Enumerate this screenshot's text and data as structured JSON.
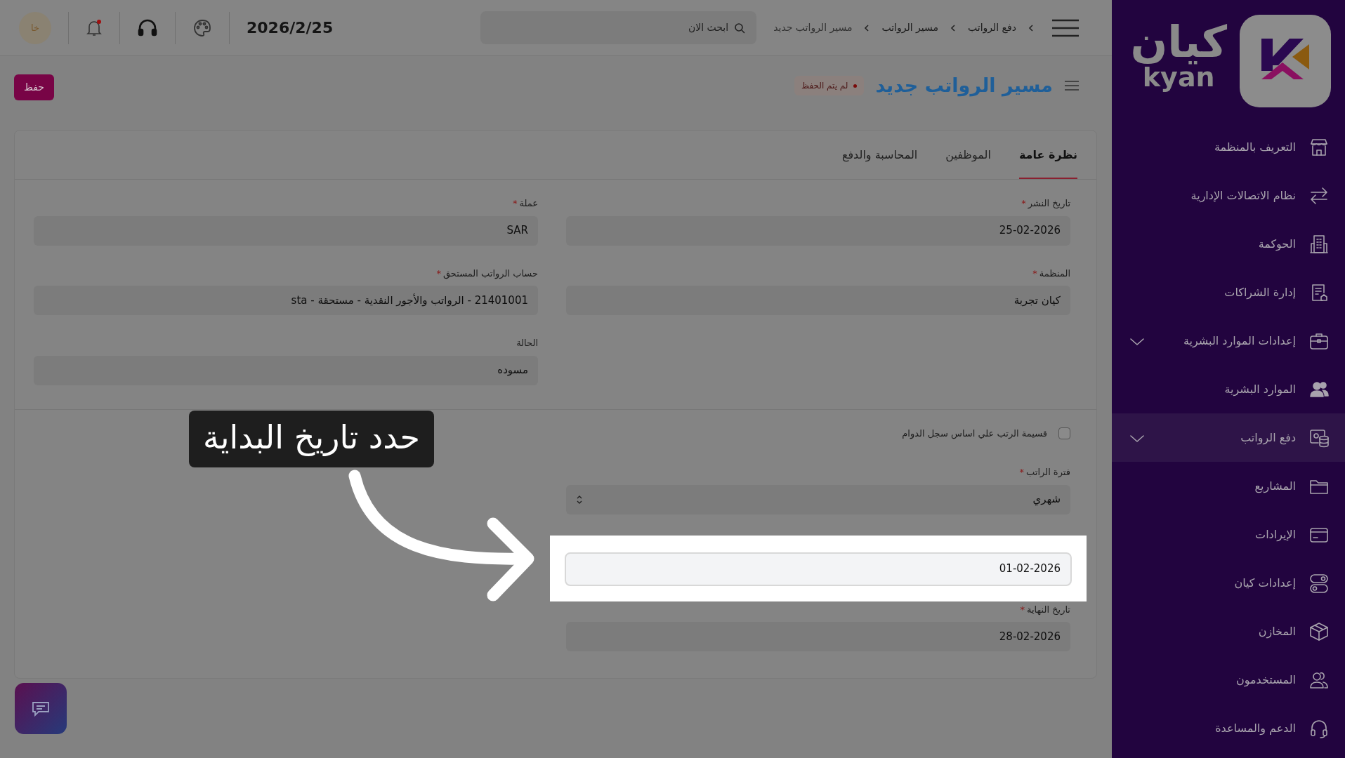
{
  "sidebar": {
    "logo": {
      "arabic": "كيان",
      "latin": "kyan"
    },
    "items": [
      {
        "label": "التعريف بالمنظمة",
        "expandable": false,
        "selected": false
      },
      {
        "label": "نظام الاتصالات الإدارية",
        "expandable": false,
        "selected": false
      },
      {
        "label": "الحوكمة",
        "expandable": false,
        "selected": false
      },
      {
        "label": "إدارة الشراكات",
        "expandable": false,
        "selected": false
      },
      {
        "label": "إعدادات الموارد البشرية",
        "expandable": true,
        "selected": false
      },
      {
        "label": "الموارد البشرية",
        "expandable": false,
        "selected": false
      },
      {
        "label": "دفع الرواتب",
        "expandable": true,
        "selected": true
      },
      {
        "label": "المشاريع",
        "expandable": false,
        "selected": false
      },
      {
        "label": "الإيرادات",
        "expandable": false,
        "selected": false
      },
      {
        "label": "إعدادات كيان",
        "expandable": false,
        "selected": false
      },
      {
        "label": "المخازن",
        "expandable": false,
        "selected": false
      },
      {
        "label": "المستخدمون",
        "expandable": false,
        "selected": false
      },
      {
        "label": "الدعم والمساعدة",
        "expandable": false,
        "selected": false
      }
    ]
  },
  "topbar": {
    "breadcrumbs": [
      "دفع الرواتب",
      "مسير الرواتب",
      "مسير الرواتب جديد"
    ],
    "search": {
      "placeholder": "ابحث الان"
    },
    "date": "2026/2/25",
    "notification_dot": true,
    "avatar": "خا"
  },
  "page": {
    "title": "مسير الرواتب جديد",
    "status_badge": "لم يتم الحفظ",
    "save_button": "حفظ"
  },
  "tabs": [
    {
      "label": "نظرة عامة",
      "selected": true
    },
    {
      "label": "الموظفين",
      "selected": false
    },
    {
      "label": "المحاسبة والدفع",
      "selected": false
    }
  ],
  "form": {
    "right_column": [
      {
        "label": "تاريخ النشر",
        "required_mark": "*",
        "value": "25-02-2026"
      },
      {
        "label": "المنظمة",
        "required_mark": "*",
        "value": "كيان تجربة"
      }
    ],
    "left_column": [
      {
        "label": "عملة",
        "required_mark": "*",
        "value": "SAR"
      },
      {
        "label": "حساب الرواتب المستحق",
        "required_mark": "*",
        "value": "21401001 - الرواتب والأجور النقدية - مستحقة - sta"
      },
      {
        "label": "الحالة",
        "value": "مسوده"
      }
    ],
    "lower_fields": [
      {
        "kind": "checkbox",
        "label": "قسيمة الرتب علي اساس سجل الدوام",
        "checked": false
      },
      {
        "kind": "select",
        "label": "فترة الراتب",
        "required_mark": "*",
        "value": "شهري"
      },
      {
        "kind": "input",
        "value": "01-02-2026",
        "highlighted": true
      },
      {
        "kind": "input",
        "label": "تاريخ النهاية",
        "required_mark": "*",
        "value": "28-02-2026",
        "highlighted": false
      }
    ]
  },
  "tutorial": {
    "text": "حدد تاريخ البداية"
  }
}
